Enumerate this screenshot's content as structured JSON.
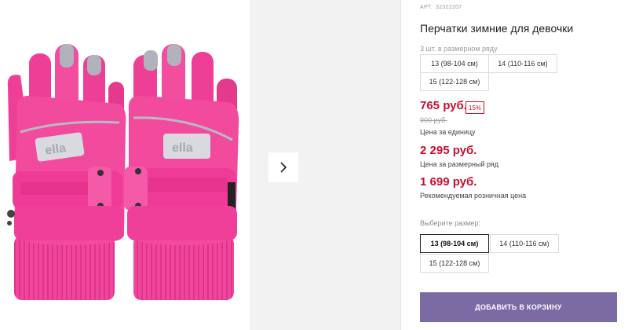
{
  "product": {
    "art_label": "АРТ.",
    "art_number": "32322207",
    "title": "Перчатки зимние для девочки",
    "image_alt": "pink winter gloves"
  },
  "pack": {
    "label": "3 шт. в размерном ряду",
    "sizes": [
      "13 (98-104 см)",
      "14 (110-116 см)",
      "15 (122-128 см)"
    ]
  },
  "pricing": {
    "unit_price": "765 руб.",
    "discount": "15%",
    "old_price": "900 руб.",
    "unit_caption": "Цена за единицу",
    "pack_price": "2 295 руб.",
    "pack_caption": "Цена за размерный ряд",
    "retail_price": "1 699 руб.",
    "retail_caption": "Рекомендуемая розничная цена"
  },
  "size_select": {
    "label": "Выберите размер:",
    "options": [
      "13 (98-104 см)",
      "14 (110-116 см)",
      "15 (122-128 см)"
    ],
    "selected": "13 (98-104 см)"
  },
  "cart": {
    "button_label": "ДОБАВИТЬ В КОРЗИНУ"
  },
  "colors": {
    "price_red": "#c8102e",
    "cart_purple": "#7b6aa3",
    "glove_pink": "#f03f98"
  },
  "icons": {
    "next": "chevron-right-icon"
  }
}
